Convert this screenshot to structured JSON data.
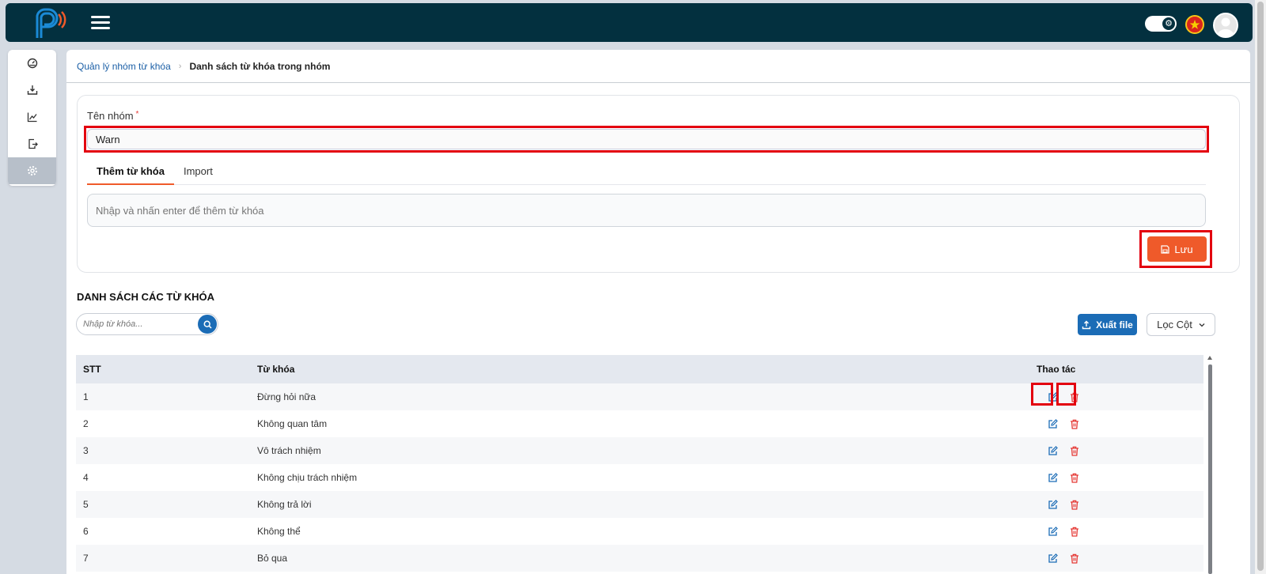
{
  "header": {
    "logo_icon": "brand-p-logo-icon",
    "menu_icon": "hamburger-menu-icon",
    "theme_toggle_icon": "gear-icon",
    "language_flag": "vietnam-flag-icon",
    "avatar_icon": "user-avatar-icon"
  },
  "sidebar": {
    "items": [
      {
        "icon": "dashboard-gauge-icon",
        "active": false
      },
      {
        "icon": "download-tray-icon",
        "active": false
      },
      {
        "icon": "line-chart-icon",
        "active": false
      },
      {
        "icon": "file-export-icon",
        "active": false
      },
      {
        "icon": "settings-gear-icon",
        "active": true
      }
    ]
  },
  "breadcrumb": {
    "parent": "Quản lý nhóm từ khóa",
    "current": "Danh sách từ khóa trong nhóm"
  },
  "form": {
    "group_name_label": "Tên nhóm",
    "required_mark": "*",
    "group_name_value": "Warn",
    "tabs": [
      {
        "label": "Thêm từ khóa",
        "active": true
      },
      {
        "label": "Import",
        "active": false
      }
    ],
    "keyword_placeholder": "Nhập và nhấn enter để thêm từ khóa",
    "save_label": "Lưu"
  },
  "list": {
    "title": "DANH SÁCH CÁC TỪ KHÓA",
    "search_placeholder": "Nhập từ khóa...",
    "export_label": "Xuất file",
    "filter_label": "Lọc Cột",
    "columns": [
      "STT",
      "Từ khóa",
      "Thao tác"
    ],
    "rows": [
      {
        "stt": "1",
        "keyword": "Đừng hỏi nữa"
      },
      {
        "stt": "2",
        "keyword": "Không quan tâm"
      },
      {
        "stt": "3",
        "keyword": "Vô trách nhiệm"
      },
      {
        "stt": "4",
        "keyword": "Không chịu trách nhiệm"
      },
      {
        "stt": "5",
        "keyword": "Không trả lời"
      },
      {
        "stt": "6",
        "keyword": "Không thể"
      },
      {
        "stt": "7",
        "keyword": "Bỏ qua"
      }
    ]
  },
  "colors": {
    "topbar": "#03303f",
    "primary": "#1b6cb6",
    "accent": "#ef5a2a",
    "delete": "#e53935",
    "highlight": "#e3000f"
  }
}
